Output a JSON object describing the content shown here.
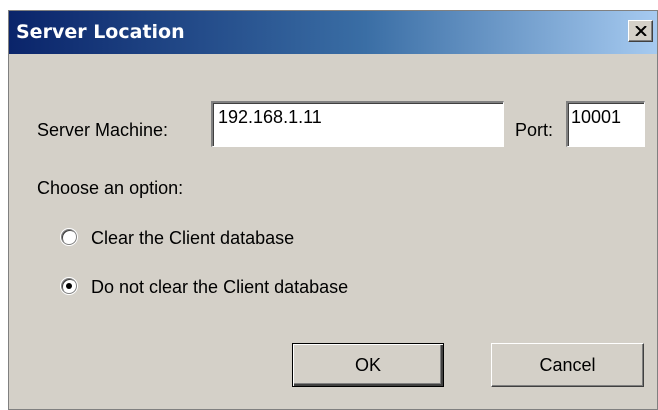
{
  "window": {
    "title": "Server Location",
    "close_glyph": "×"
  },
  "server": {
    "machine_label": "Server Machine:",
    "machine_value": "192.168.1.11",
    "port_label": "Port:",
    "port_value": "10001"
  },
  "options": {
    "heading": "Choose an option:",
    "items": [
      {
        "label": "Clear the Client database",
        "selected": false
      },
      {
        "label": "Do not clear the Client database",
        "selected": true
      }
    ]
  },
  "buttons": {
    "ok_label": "OK",
    "cancel_label": "Cancel"
  },
  "colors": {
    "titlebar_start": "#0a246a",
    "titlebar_end": "#a6caf0",
    "dialog_face": "#d4d0c8"
  }
}
